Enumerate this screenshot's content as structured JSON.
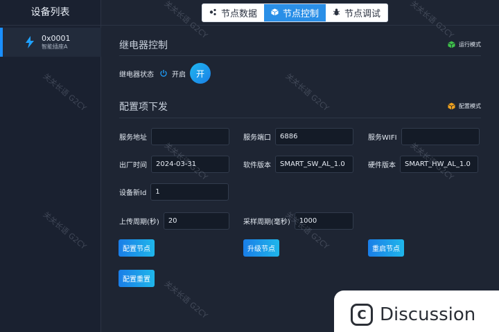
{
  "sidebar": {
    "title": "设备列表",
    "devices": [
      {
        "id": "0x0001",
        "name": "智能插座A",
        "icon": "bolt-icon"
      }
    ]
  },
  "tabs": [
    {
      "label": "节点数据",
      "icon": "dots-icon",
      "active": false
    },
    {
      "label": "节点控制",
      "icon": "cube-icon",
      "active": true
    },
    {
      "label": "节点调试",
      "icon": "bug-icon",
      "active": false
    }
  ],
  "relay": {
    "title": "继电器控制",
    "mode_label": "运行模式",
    "status_label": "继电器状态",
    "status_value": "开启",
    "toggle_label": "开"
  },
  "config": {
    "title": "配置项下发",
    "mode_label": "配置模式",
    "server_address": {
      "label": "服务地址",
      "value": ""
    },
    "server_port": {
      "label": "服务端口",
      "value": "6886"
    },
    "service_wifi": {
      "label": "服务WIFI",
      "value": ""
    },
    "factory_date": {
      "label": "出厂时间",
      "value": "2024-03-31"
    },
    "software_version": {
      "label": "软件版本",
      "value": "SMART_SW_AL_1.0"
    },
    "hardware_version": {
      "label": "硬件版本",
      "value": "SMART_HW_AL_1.0"
    },
    "new_device_id": {
      "label": "设备新Id",
      "value": "1"
    },
    "upload_period": {
      "label": "上传周期(秒)",
      "value": "20"
    },
    "sample_period": {
      "label": "采样周期(毫秒)",
      "value": "1000"
    },
    "buttons": {
      "configure_node": "配置节点",
      "upgrade_node": "升级节点",
      "restart_node": "重启节点",
      "reset_config": "配置重置"
    }
  },
  "watermark": "关关长语 G2CY",
  "discussion_label": "Discussion",
  "colors": {
    "accent": "#2a8fe7",
    "background": "#1e2533",
    "sidebar": "#1a2130"
  }
}
